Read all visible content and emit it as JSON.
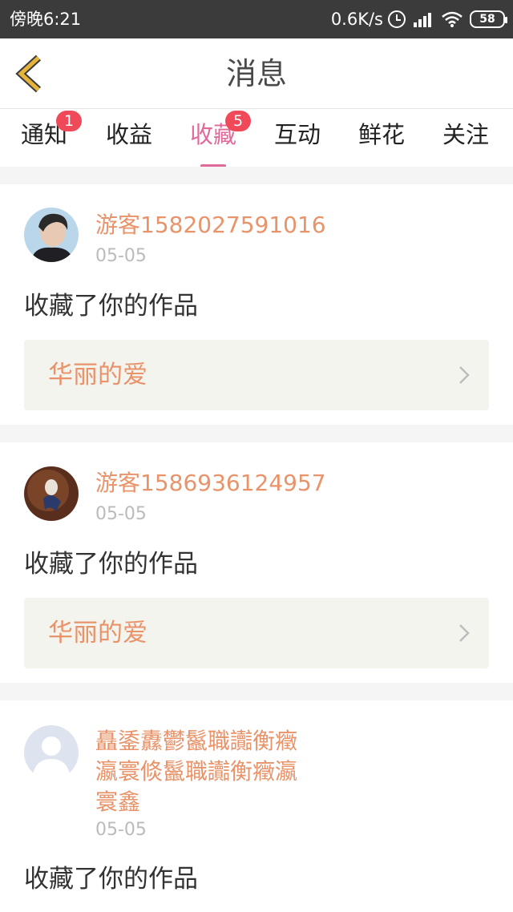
{
  "status_bar": {
    "time": "傍晚6:21",
    "net_speed": "0.6K/s",
    "battery": "58",
    "icons": [
      "alarm-icon",
      "signal-icon",
      "wifi-icon",
      "battery-icon"
    ]
  },
  "header": {
    "back_icon": "chevron-left-icon",
    "title": "消息"
  },
  "tabs": [
    {
      "label": "通知",
      "badge": "1"
    },
    {
      "label": "收益",
      "badge": ""
    },
    {
      "label": "收藏",
      "badge": "5",
      "active": true
    },
    {
      "label": "互动",
      "badge": ""
    },
    {
      "label": "鲜花",
      "badge": ""
    },
    {
      "label": "关注",
      "badge": ""
    }
  ],
  "feed": [
    {
      "user": "游客1582027591016",
      "date": "05-05",
      "action": "收藏了你的作品",
      "work_title": "华丽的爱"
    },
    {
      "user": "游客1586936124957",
      "date": "05-05",
      "action": "收藏了你的作品",
      "work_title": "华丽的爱"
    },
    {
      "user_lines": [
        "矗鋈纛鬱鬣職讟衡癥",
        "瀛寰倐鬣職讟衡癥瀛",
        "寰鑫"
      ],
      "date": "05-05",
      "action": "收藏了你的作品"
    }
  ],
  "colors": {
    "accent": "#e0699a",
    "username": "#e8936a",
    "badge": "#f04a5a",
    "back_icon": "#e5b43a"
  }
}
